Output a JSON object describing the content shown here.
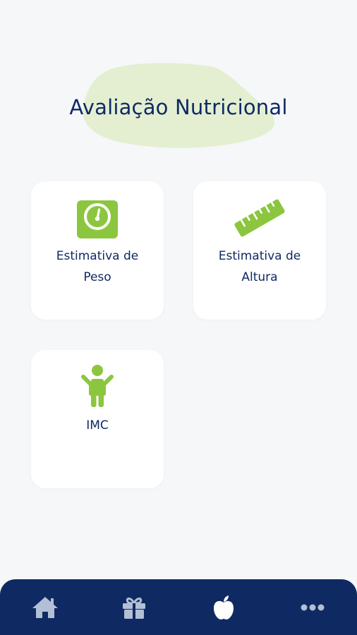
{
  "header": {
    "title": "Avaliação Nutricional"
  },
  "cards": [
    {
      "name": "weight-estimate",
      "label_line1": "Estimativa de",
      "label_line2": "Peso",
      "icon": "scale-icon"
    },
    {
      "name": "height-estimate",
      "label_line1": "Estimativa de",
      "label_line2": "Altura",
      "icon": "ruler-icon"
    },
    {
      "name": "bmi",
      "label_line1": "IMC",
      "icon": "child-figure-icon"
    }
  ],
  "bottom_nav": {
    "items": [
      {
        "name": "home",
        "icon": "home-icon",
        "active": false
      },
      {
        "name": "gifts",
        "icon": "gift-icon",
        "active": false
      },
      {
        "name": "nutrition",
        "icon": "apple-icon",
        "active": true
      },
      {
        "name": "more",
        "icon": "more-dots-icon",
        "active": false
      }
    ]
  },
  "colors": {
    "background": "#f6f7f9",
    "primary_navy": "#0f2a62",
    "accent_green": "#8cc63f",
    "blob_green": "#e4efd2",
    "nav_icon_inactive": "#b3bfd6",
    "nav_icon_active": "#ffffff"
  }
}
